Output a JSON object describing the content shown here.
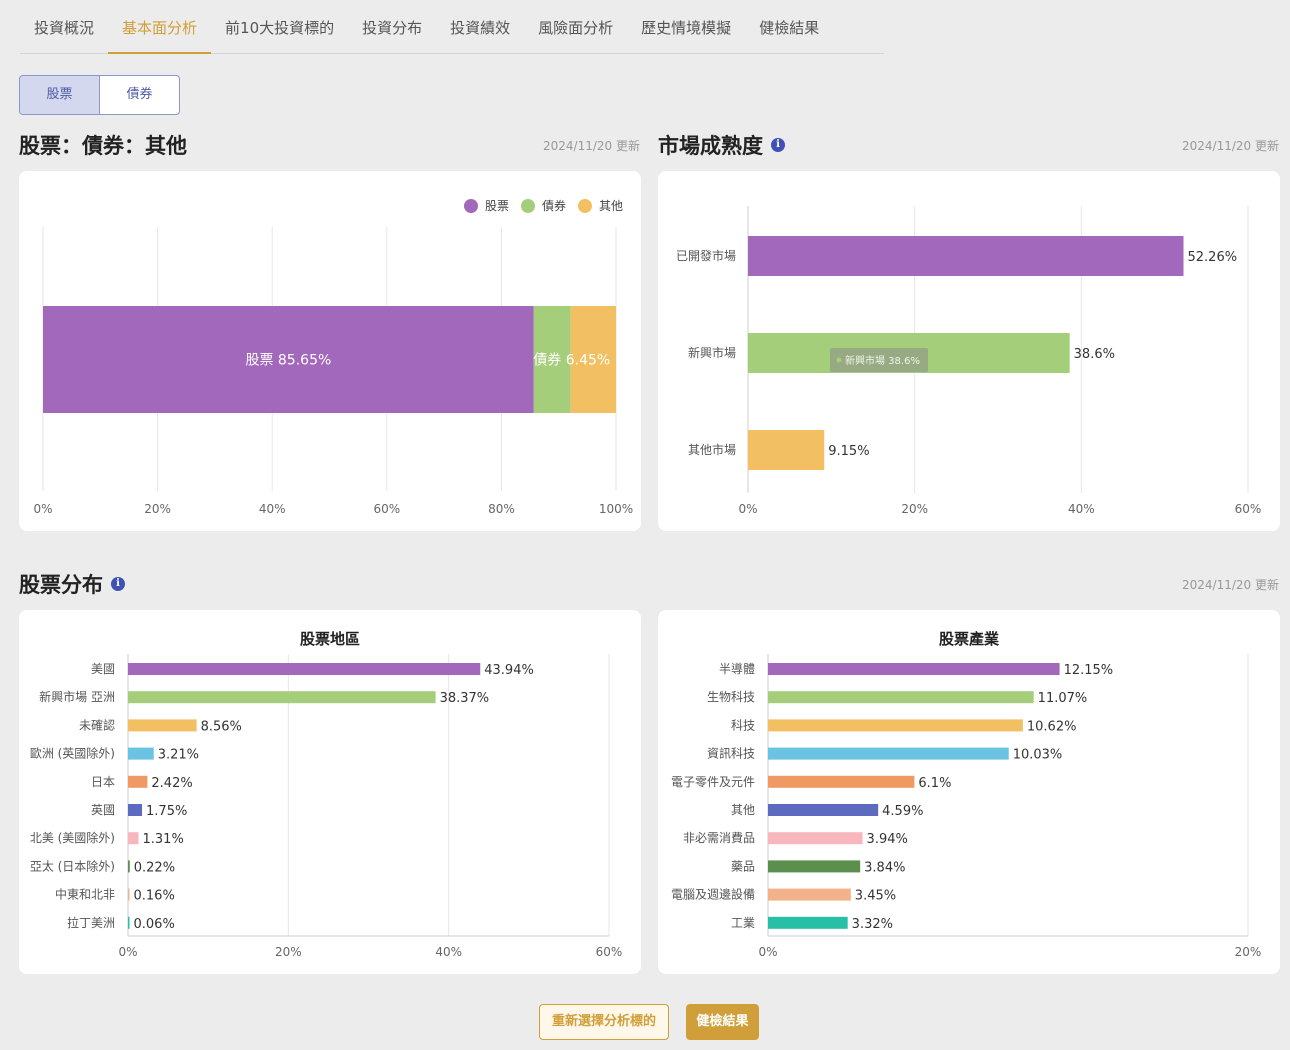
{
  "tabs": [
    {
      "label": "投資概況"
    },
    {
      "label": "基本面分析"
    },
    {
      "label": "前10大投資標的"
    },
    {
      "label": "投資分布"
    },
    {
      "label": "投資績效"
    },
    {
      "label": "風險面分析"
    },
    {
      "label": "歷史情境模擬"
    },
    {
      "label": "健檢結果"
    }
  ],
  "active_tab": "基本面分析",
  "toggle": {
    "stock": "股票",
    "bond": "債券",
    "selected": "股票"
  },
  "section1": {
    "title": "股票：債券：其他",
    "updated": "2024/11/20 更新"
  },
  "section2": {
    "title": "市場成熟度",
    "updated": "2024/11/20 更新"
  },
  "section3": {
    "title": "股票分布",
    "updated": "2024/11/20 更新"
  },
  "buttons": {
    "reselect": "重新選擇分析標的",
    "result": "健檢結果"
  },
  "colors": {
    "accent": "#d19f3a",
    "palette": [
      "#a268bb",
      "#a5ce7a",
      "#f3bf63",
      "#6bc3e3",
      "#ef9a62",
      "#5c6bc0",
      "#f8b6bd",
      "#5a8f4d",
      "#f4b28a",
      "#28bfa7"
    ]
  },
  "chart_data": [
    {
      "type": "bar",
      "orientation": "horizontal-stacked",
      "series": [
        {
          "name": "股票",
          "values": [
            85.65
          ],
          "label": "股票 85.65%"
        },
        {
          "name": "債券",
          "values": [
            6.45
          ],
          "label": "債券 6.45%"
        },
        {
          "name": "其他",
          "values": [
            7.9
          ]
        }
      ],
      "xlim": [
        0,
        100
      ],
      "xticks": [
        "0%",
        "20%",
        "40%",
        "60%",
        "80%",
        "100%"
      ],
      "legend": "top-right"
    },
    {
      "type": "bar",
      "orientation": "horizontal",
      "categories": [
        "已開發市場",
        "新興市場",
        "其他市場"
      ],
      "values": [
        52.26,
        38.6,
        9.15
      ],
      "labels": [
        "52.26%",
        "38.6%",
        "9.15%"
      ],
      "xlim": [
        0,
        60
      ],
      "xticks": [
        "0%",
        "20%",
        "40%",
        "60%"
      ],
      "tooltip": "新興市場 38.6%"
    },
    {
      "type": "bar",
      "orientation": "horizontal",
      "title": "股票地區",
      "categories": [
        "美國",
        "新興市場 亞洲",
        "未確認",
        "歐洲 (英國除外)",
        "日本",
        "英國",
        "北美 (美國除外)",
        "亞太 (日本除外)",
        "中東和北非",
        "拉丁美洲"
      ],
      "values": [
        43.94,
        38.37,
        8.56,
        3.21,
        2.42,
        1.75,
        1.31,
        0.22,
        0.16,
        0.06
      ],
      "labels": [
        "43.94%",
        "38.37%",
        "8.56%",
        "3.21%",
        "2.42%",
        "1.75%",
        "1.31%",
        "0.22%",
        "0.16%",
        "0.06%"
      ],
      "xlim": [
        0,
        60
      ],
      "xticks": [
        "0%",
        "20%",
        "40%",
        "60%"
      ]
    },
    {
      "type": "bar",
      "orientation": "horizontal",
      "title": "股票產業",
      "categories": [
        "半導體",
        "生物科技",
        "科技",
        "資訊科技",
        "電子零件及元件",
        "其他",
        "非必需消費品",
        "藥品",
        "電腦及週邊設備",
        "工業"
      ],
      "values": [
        12.15,
        11.07,
        10.62,
        10.03,
        6.1,
        4.59,
        3.94,
        3.84,
        3.45,
        3.32
      ],
      "labels": [
        "12.15%",
        "11.07%",
        "10.62%",
        "10.03%",
        "6.1%",
        "4.59%",
        "3.94%",
        "3.84%",
        "3.45%",
        "3.32%"
      ],
      "xlim": [
        0,
        20
      ],
      "xticks": [
        "0%",
        "20%"
      ]
    }
  ]
}
